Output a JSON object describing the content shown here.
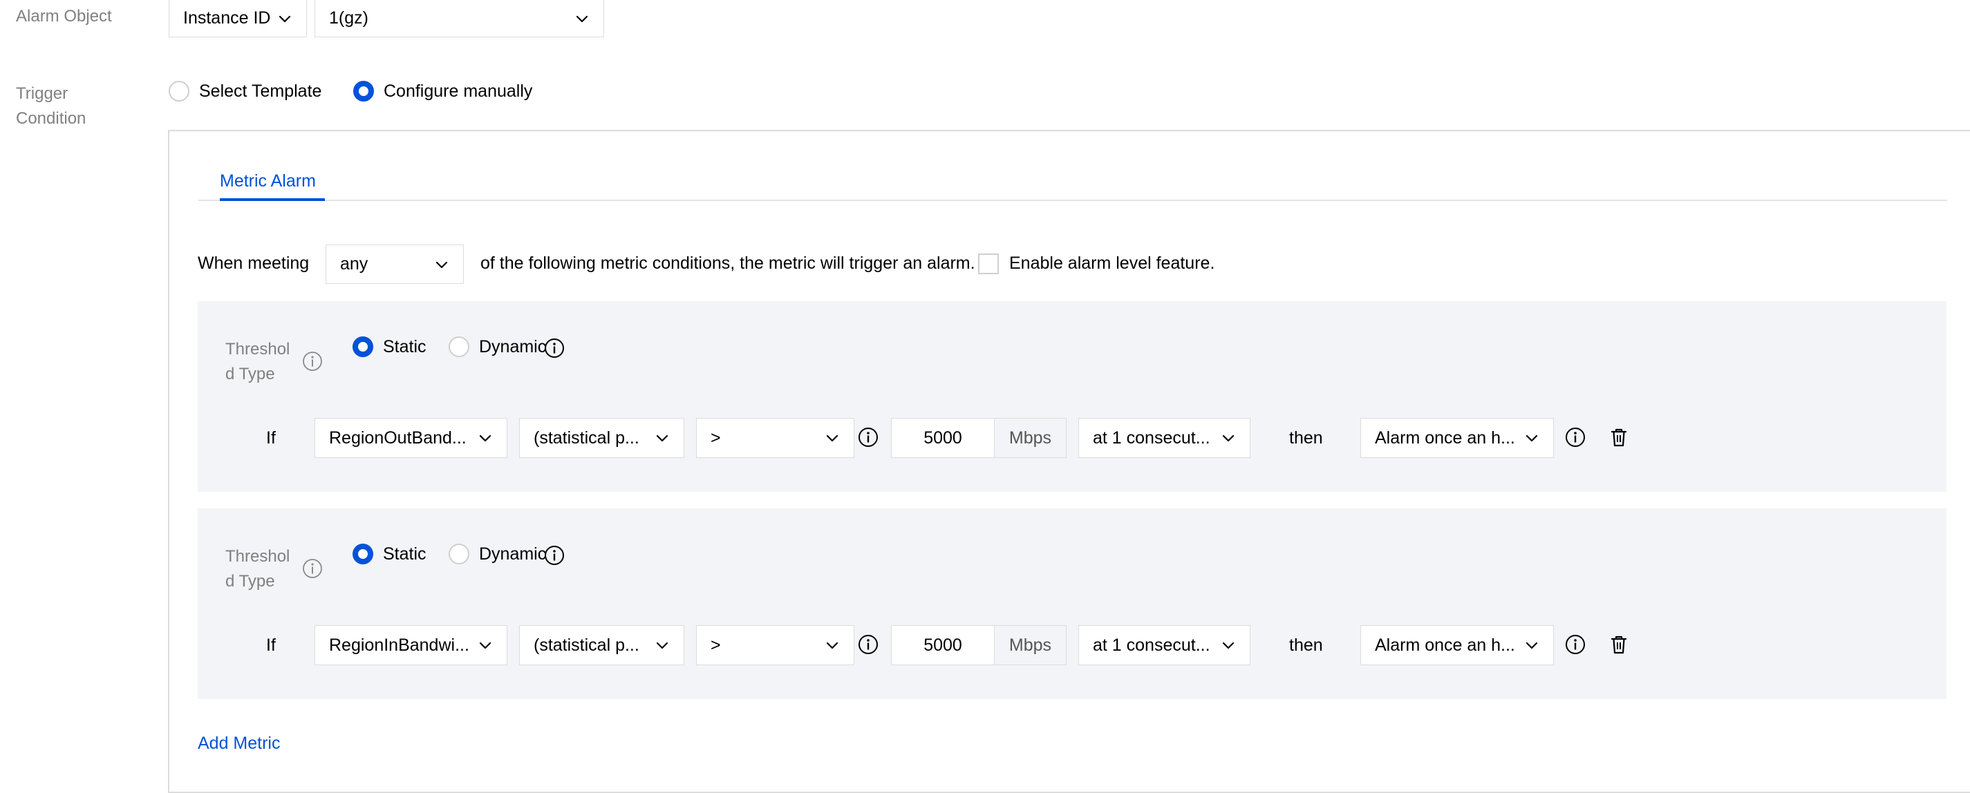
{
  "alarm_object": {
    "label": "Alarm Object",
    "object_type": "Instance ID",
    "instance": "1(gz)"
  },
  "trigger_condition": {
    "label_line1": "Trigger",
    "label_line2": "Condition",
    "options": [
      "Select Template",
      "Configure manually"
    ],
    "selected": "Configure manually"
  },
  "tabs": [
    {
      "label": "Metric Alarm",
      "active": true
    }
  ],
  "rule": {
    "prefix": "When meeting",
    "match": "any",
    "suffix": "of the following metric conditions, the metric will trigger an alarm.",
    "alarm_level_label": "Enable alarm level feature.",
    "alarm_level_checked": false
  },
  "conditions": [
    {
      "threshold_label_line1": "Threshol",
      "threshold_label_line2": "d Type",
      "static_label": "Static",
      "dynamic_label": "Dynamic",
      "selected": "Static",
      "if_label": "If",
      "metric": "RegionOutBand...",
      "stat": "(statistical p...",
      "operator": ">",
      "value": "5000",
      "unit": "Mbps",
      "period": "at 1 consecut...",
      "then_label": "then",
      "action": "Alarm once an h..."
    },
    {
      "threshold_label_line1": "Threshol",
      "threshold_label_line2": "d Type",
      "static_label": "Static",
      "dynamic_label": "Dynamic",
      "selected": "Static",
      "if_label": "If",
      "metric": "RegionInBandwi...",
      "stat": "(statistical p...",
      "operator": ">",
      "value": "5000",
      "unit": "Mbps",
      "period": "at 1 consecut...",
      "then_label": "then",
      "action": "Alarm once an h..."
    }
  ],
  "add_metric_label": "Add Metric",
  "colors": {
    "accent": "#0052d9",
    "panel_bg": "#f3f4f7",
    "border": "#dcdcdc",
    "label_gray": "#808080"
  }
}
